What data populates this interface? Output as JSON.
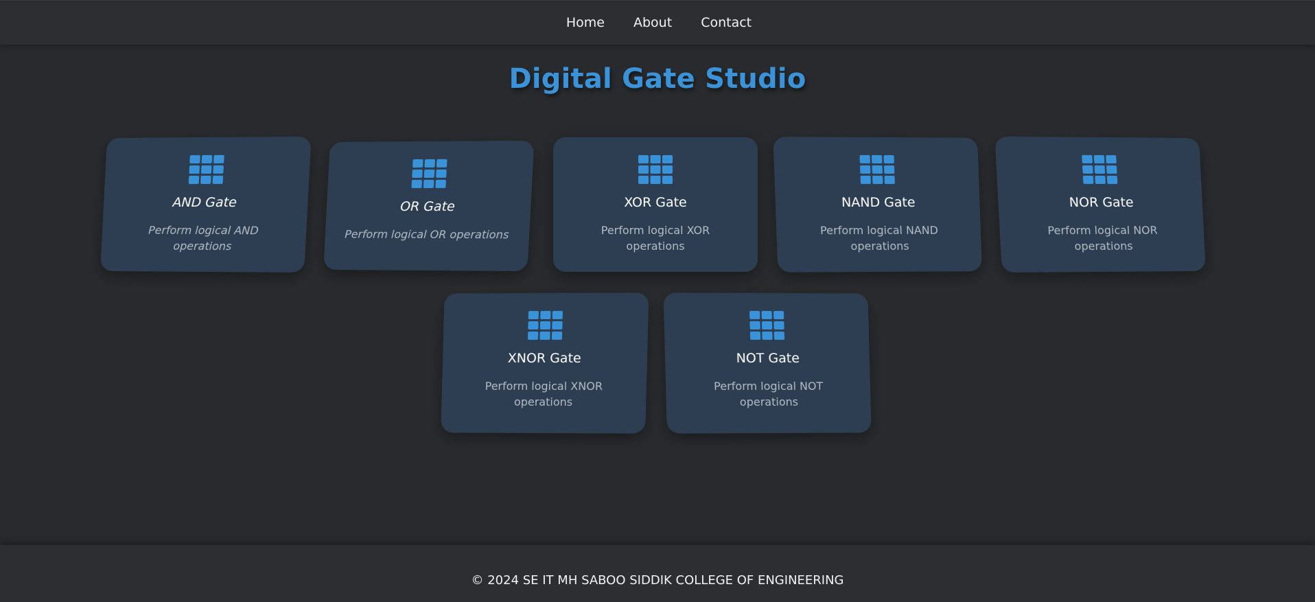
{
  "nav": {
    "items": [
      {
        "label": "Home"
      },
      {
        "label": "About"
      },
      {
        "label": "Contact"
      }
    ]
  },
  "page": {
    "title": "Digital Gate Studio"
  },
  "cards": [
    {
      "title": "AND Gate",
      "desc": "Perform logical AND operations",
      "icon": "grid-icon"
    },
    {
      "title": "OR Gate",
      "desc": "Perform logical OR operations",
      "icon": "grid-icon"
    },
    {
      "title": "XOR Gate",
      "desc": "Perform logical XOR operations",
      "icon": "grid-icon"
    },
    {
      "title": "NAND Gate",
      "desc": "Perform logical NAND operations",
      "icon": "grid-icon"
    },
    {
      "title": "NOR Gate",
      "desc": "Perform logical NOR operations",
      "icon": "grid-icon"
    },
    {
      "title": "XNOR Gate",
      "desc": "Perform logical XNOR operations",
      "icon": "grid-icon"
    },
    {
      "title": "NOT Gate",
      "desc": "Perform logical NOT operations",
      "icon": "grid-icon"
    }
  ],
  "footer": {
    "text": "© 2024 SE IT MH SABOO SIDDIK COLLEGE OF ENGINEERING"
  },
  "colors": {
    "accent": "#3a93d8",
    "card_bg": "#2d3e52",
    "page_bg": "#282a2d"
  }
}
